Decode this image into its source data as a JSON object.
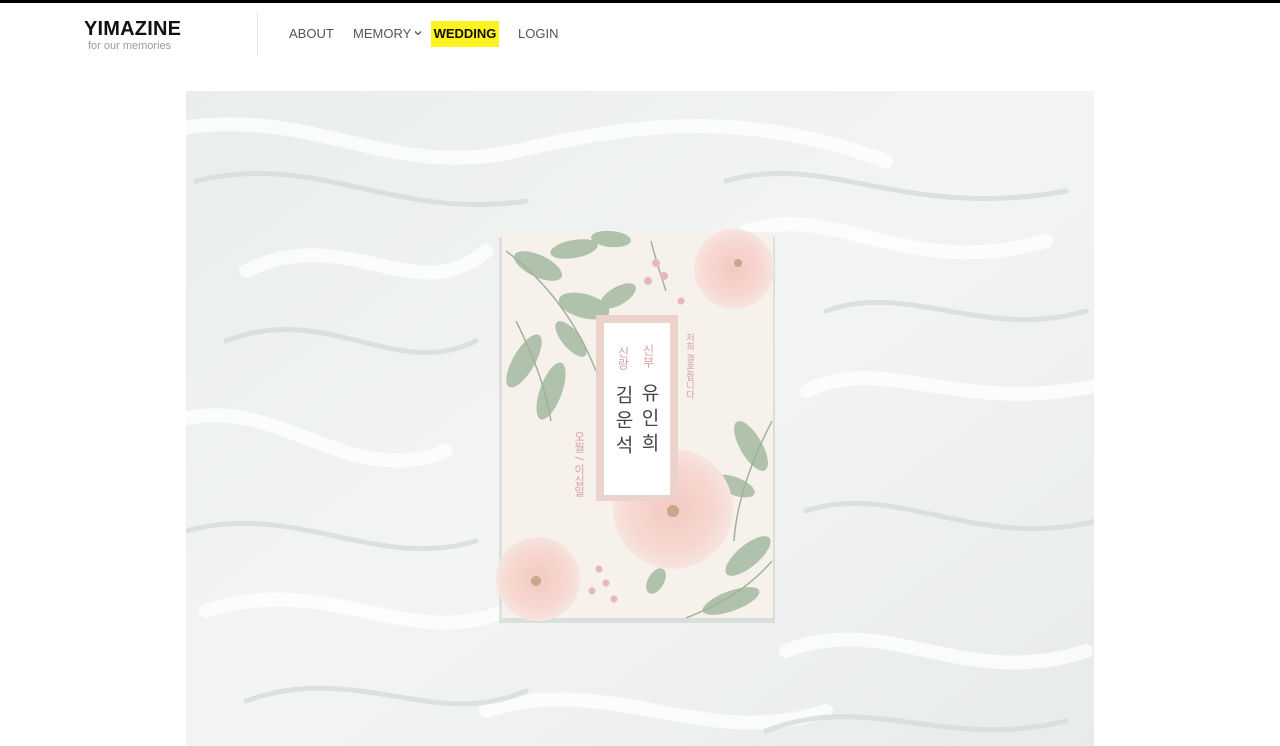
{
  "brand": {
    "title": "YIMAZINE",
    "tagline": "for our memories"
  },
  "nav": {
    "items": [
      {
        "label": "ABOUT"
      },
      {
        "label": "MEMORY"
      },
      {
        "label": "WEDDING"
      },
      {
        "label": "LOGIN"
      }
    ],
    "active": "WEDDING",
    "active_color": "#fff21f"
  },
  "hero": {
    "card": {
      "role_bride": "신부",
      "role_groom": "신랑",
      "name_bride": "유인희",
      "name_groom": "김운석",
      "date_text": "오월 / 이십일",
      "note_text": "저희 결혼합니다"
    }
  }
}
